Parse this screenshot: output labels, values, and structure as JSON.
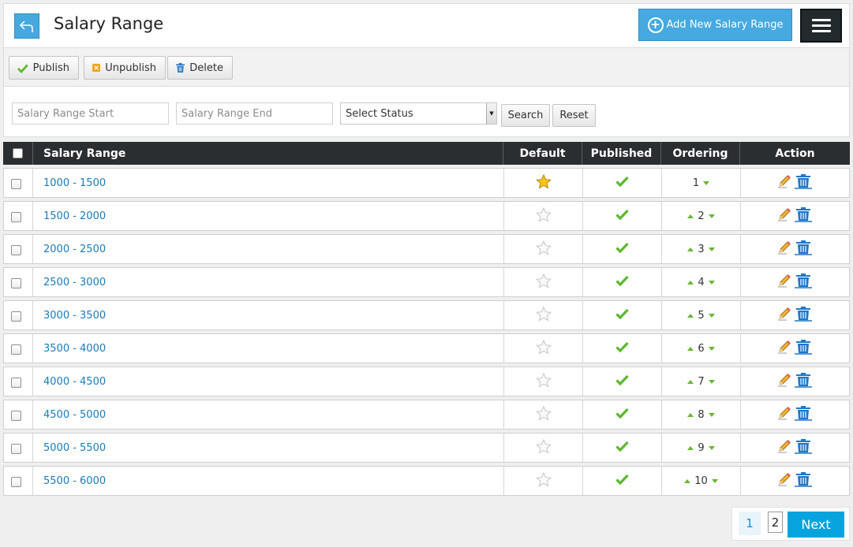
{
  "header": {
    "title": "Salary Range",
    "back_icon": "back-arrow-icon",
    "add_button_label": "Add New Salary Range",
    "menu_icon": "hamburger-menu-icon"
  },
  "toolbar": {
    "publish_label": "Publish",
    "unpublish_label": "Unpublish",
    "delete_label": "Delete"
  },
  "filters": {
    "range_start_placeholder": "Salary Range Start",
    "range_end_placeholder": "Salary Range End",
    "status_selected": "Select Status",
    "search_label": "Search",
    "reset_label": "Reset"
  },
  "table": {
    "columns": [
      "Salary Range",
      "Default",
      "Published",
      "Ordering",
      "Action"
    ],
    "rows": [
      {
        "range": "1000 - 1500",
        "default": true,
        "published": true,
        "order": "1"
      },
      {
        "range": "1500 - 2000",
        "default": false,
        "published": true,
        "order": "2"
      },
      {
        "range": "2000 - 2500",
        "default": false,
        "published": true,
        "order": "3"
      },
      {
        "range": "2500 - 3000",
        "default": false,
        "published": true,
        "order": "4"
      },
      {
        "range": "3000 - 3500",
        "default": false,
        "published": true,
        "order": "5"
      },
      {
        "range": "3500 - 4000",
        "default": false,
        "published": true,
        "order": "6"
      },
      {
        "range": "4000 - 4500",
        "default": false,
        "published": true,
        "order": "7"
      },
      {
        "range": "4500 - 5000",
        "default": false,
        "published": true,
        "order": "8"
      },
      {
        "range": "5000 - 5500",
        "default": false,
        "published": true,
        "order": "9"
      },
      {
        "range": "5500 - 6000",
        "default": false,
        "published": true,
        "order": "10"
      }
    ]
  },
  "pagination": {
    "current": "1",
    "pages": [
      "1",
      "2"
    ],
    "next_label": "Next"
  },
  "colors": {
    "accent": "#46a9e0",
    "header_dark": "#2a2e30",
    "link": "#1a7ab8",
    "success": "#5cb82e"
  }
}
